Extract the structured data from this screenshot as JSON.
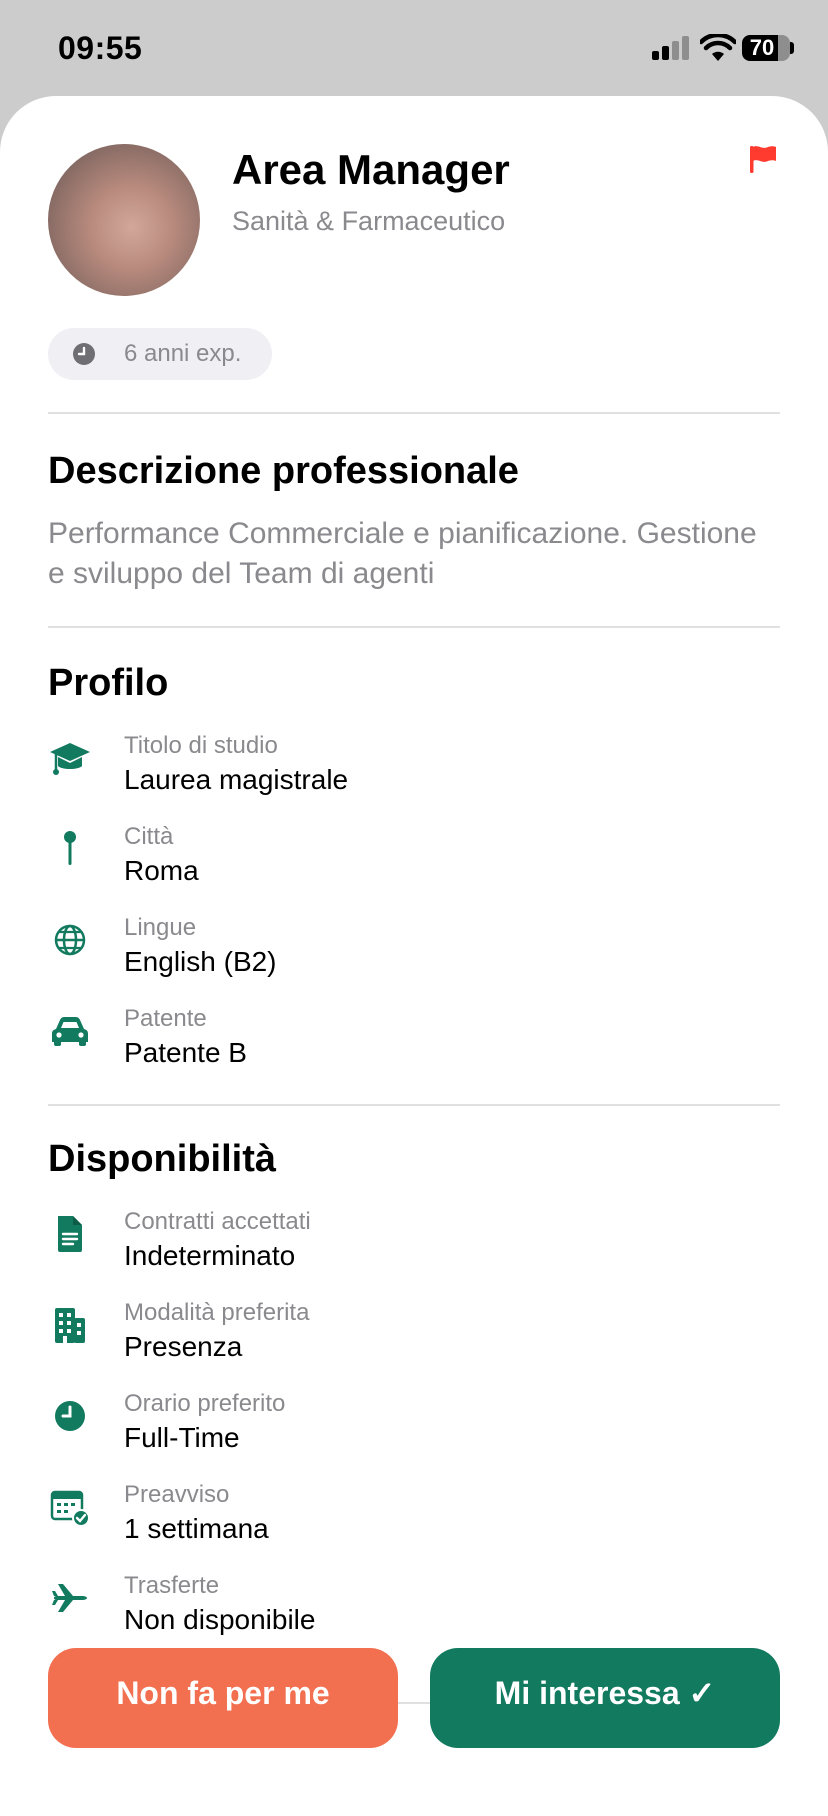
{
  "status_bar": {
    "time": "09:55",
    "battery": "70"
  },
  "profile": {
    "title": "Area Manager",
    "sector": "Sanità & Farmaceutico",
    "experience": "6 anni exp."
  },
  "description": {
    "heading": "Descrizione professionale",
    "text": "Performance Commerciale e pianificazione. Gestione e sviluppo del Team di agenti"
  },
  "profilo": {
    "heading": "Profilo",
    "items": [
      {
        "label": "Titolo di studio",
        "value": "Laurea magistrale",
        "icon": "graduation-cap-icon"
      },
      {
        "label": "Città",
        "value": "Roma",
        "icon": "pin-icon"
      },
      {
        "label": "Lingue",
        "value": "English (B2)",
        "icon": "globe-icon"
      },
      {
        "label": "Patente",
        "value": "Patente B",
        "icon": "car-icon"
      }
    ]
  },
  "disponibilita": {
    "heading": "Disponibilità",
    "items": [
      {
        "label": "Contratti accettati",
        "value": "Indeterminato",
        "icon": "document-icon"
      },
      {
        "label": "Modalità preferita",
        "value": "Presenza",
        "icon": "building-icon"
      },
      {
        "label": "Orario preferito",
        "value": "Full-Time",
        "icon": "clock-icon"
      },
      {
        "label": "Preavviso",
        "value": "1 settimana",
        "icon": "calendar-check-icon"
      },
      {
        "label": "Trasferte",
        "value": "Non disponibile",
        "icon": "airplane-icon"
      }
    ]
  },
  "actions": {
    "reject": "Non fa per me",
    "accept": "Mi interessa ✓"
  },
  "colors": {
    "accent": "#127a5f",
    "reject": "#f26f50",
    "flag": "#ff3b30",
    "muted_text": "#8a8a8e"
  }
}
